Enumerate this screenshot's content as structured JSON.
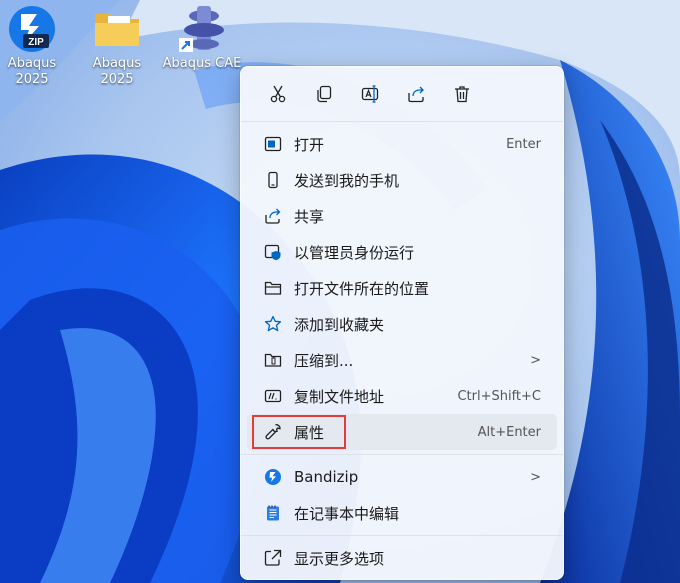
{
  "desktop": {
    "icons": [
      {
        "label": "Abaqus\n2025",
        "icon": "bandizip-zip-icon"
      },
      {
        "label": "Abaqus\n2025",
        "icon": "folder-icon"
      },
      {
        "label": "Abaqus CAE",
        "icon": "abaqus-cae-shortcut-icon"
      }
    ]
  },
  "context_menu": {
    "toolbar": [
      {
        "icon": "cut-icon"
      },
      {
        "icon": "copy-icon"
      },
      {
        "icon": "rename-icon"
      },
      {
        "icon": "share-icon"
      },
      {
        "icon": "delete-icon"
      }
    ],
    "items": [
      {
        "label": "打开",
        "shortcut": "Enter",
        "icon": "open-icon"
      },
      {
        "label": "发送到我的手机",
        "shortcut": "",
        "icon": "phone-icon"
      },
      {
        "label": "共享",
        "shortcut": "",
        "icon": "share-icon"
      },
      {
        "label": "以管理员身份运行",
        "shortcut": "",
        "icon": "admin-shield-icon"
      },
      {
        "label": "打开文件所在的位置",
        "shortcut": "",
        "icon": "folder-icon"
      },
      {
        "label": "添加到收藏夹",
        "shortcut": "",
        "icon": "star-icon"
      },
      {
        "label": "压缩到...",
        "shortcut": "",
        "icon": "compress-icon",
        "submenu": ">"
      },
      {
        "label": "复制文件地址",
        "shortcut": "Ctrl+Shift+C",
        "icon": "copy-path-icon"
      },
      {
        "label": "属性",
        "shortcut": "Alt+Enter",
        "icon": "wrench-icon"
      },
      {
        "label": "Bandizip",
        "shortcut": "",
        "icon": "bandizip-icon",
        "submenu": ">"
      },
      {
        "label": "在记事本中编辑",
        "shortcut": "",
        "icon": "notepad-icon"
      },
      {
        "label": "显示更多选项",
        "shortcut": "",
        "icon": "more-options-icon"
      }
    ]
  },
  "colors": {
    "accent": "#0067c0",
    "highlight_border": "#e23c3c",
    "hover_bg": "#e4e8ef"
  }
}
